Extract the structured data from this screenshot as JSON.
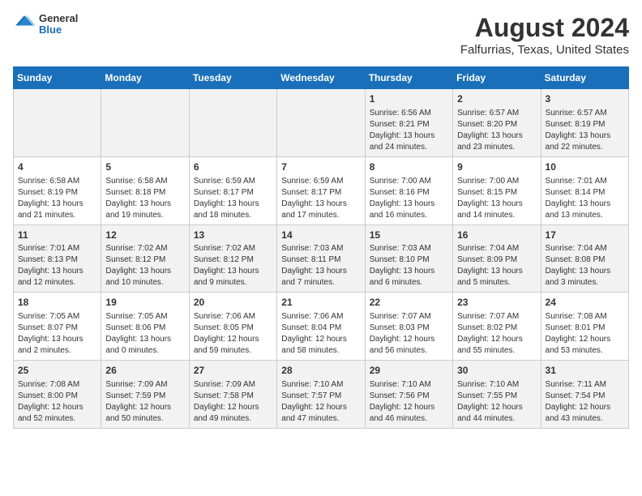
{
  "header": {
    "logo_general": "General",
    "logo_blue": "Blue",
    "title": "August 2024",
    "subtitle": "Falfurrias, Texas, United States"
  },
  "days_of_week": [
    "Sunday",
    "Monday",
    "Tuesday",
    "Wednesday",
    "Thursday",
    "Friday",
    "Saturday"
  ],
  "weeks": [
    [
      {
        "day": "",
        "info": ""
      },
      {
        "day": "",
        "info": ""
      },
      {
        "day": "",
        "info": ""
      },
      {
        "day": "",
        "info": ""
      },
      {
        "day": "1",
        "info": "Sunrise: 6:56 AM\nSunset: 8:21 PM\nDaylight: 13 hours\nand 24 minutes."
      },
      {
        "day": "2",
        "info": "Sunrise: 6:57 AM\nSunset: 8:20 PM\nDaylight: 13 hours\nand 23 minutes."
      },
      {
        "day": "3",
        "info": "Sunrise: 6:57 AM\nSunset: 8:19 PM\nDaylight: 13 hours\nand 22 minutes."
      }
    ],
    [
      {
        "day": "4",
        "info": "Sunrise: 6:58 AM\nSunset: 8:19 PM\nDaylight: 13 hours\nand 21 minutes."
      },
      {
        "day": "5",
        "info": "Sunrise: 6:58 AM\nSunset: 8:18 PM\nDaylight: 13 hours\nand 19 minutes."
      },
      {
        "day": "6",
        "info": "Sunrise: 6:59 AM\nSunset: 8:17 PM\nDaylight: 13 hours\nand 18 minutes."
      },
      {
        "day": "7",
        "info": "Sunrise: 6:59 AM\nSunset: 8:17 PM\nDaylight: 13 hours\nand 17 minutes."
      },
      {
        "day": "8",
        "info": "Sunrise: 7:00 AM\nSunset: 8:16 PM\nDaylight: 13 hours\nand 16 minutes."
      },
      {
        "day": "9",
        "info": "Sunrise: 7:00 AM\nSunset: 8:15 PM\nDaylight: 13 hours\nand 14 minutes."
      },
      {
        "day": "10",
        "info": "Sunrise: 7:01 AM\nSunset: 8:14 PM\nDaylight: 13 hours\nand 13 minutes."
      }
    ],
    [
      {
        "day": "11",
        "info": "Sunrise: 7:01 AM\nSunset: 8:13 PM\nDaylight: 13 hours\nand 12 minutes."
      },
      {
        "day": "12",
        "info": "Sunrise: 7:02 AM\nSunset: 8:12 PM\nDaylight: 13 hours\nand 10 minutes."
      },
      {
        "day": "13",
        "info": "Sunrise: 7:02 AM\nSunset: 8:12 PM\nDaylight: 13 hours\nand 9 minutes."
      },
      {
        "day": "14",
        "info": "Sunrise: 7:03 AM\nSunset: 8:11 PM\nDaylight: 13 hours\nand 7 minutes."
      },
      {
        "day": "15",
        "info": "Sunrise: 7:03 AM\nSunset: 8:10 PM\nDaylight: 13 hours\nand 6 minutes."
      },
      {
        "day": "16",
        "info": "Sunrise: 7:04 AM\nSunset: 8:09 PM\nDaylight: 13 hours\nand 5 minutes."
      },
      {
        "day": "17",
        "info": "Sunrise: 7:04 AM\nSunset: 8:08 PM\nDaylight: 13 hours\nand 3 minutes."
      }
    ],
    [
      {
        "day": "18",
        "info": "Sunrise: 7:05 AM\nSunset: 8:07 PM\nDaylight: 13 hours\nand 2 minutes."
      },
      {
        "day": "19",
        "info": "Sunrise: 7:05 AM\nSunset: 8:06 PM\nDaylight: 13 hours\nand 0 minutes."
      },
      {
        "day": "20",
        "info": "Sunrise: 7:06 AM\nSunset: 8:05 PM\nDaylight: 12 hours\nand 59 minutes."
      },
      {
        "day": "21",
        "info": "Sunrise: 7:06 AM\nSunset: 8:04 PM\nDaylight: 12 hours\nand 58 minutes."
      },
      {
        "day": "22",
        "info": "Sunrise: 7:07 AM\nSunset: 8:03 PM\nDaylight: 12 hours\nand 56 minutes."
      },
      {
        "day": "23",
        "info": "Sunrise: 7:07 AM\nSunset: 8:02 PM\nDaylight: 12 hours\nand 55 minutes."
      },
      {
        "day": "24",
        "info": "Sunrise: 7:08 AM\nSunset: 8:01 PM\nDaylight: 12 hours\nand 53 minutes."
      }
    ],
    [
      {
        "day": "25",
        "info": "Sunrise: 7:08 AM\nSunset: 8:00 PM\nDaylight: 12 hours\nand 52 minutes."
      },
      {
        "day": "26",
        "info": "Sunrise: 7:09 AM\nSunset: 7:59 PM\nDaylight: 12 hours\nand 50 minutes."
      },
      {
        "day": "27",
        "info": "Sunrise: 7:09 AM\nSunset: 7:58 PM\nDaylight: 12 hours\nand 49 minutes."
      },
      {
        "day": "28",
        "info": "Sunrise: 7:10 AM\nSunset: 7:57 PM\nDaylight: 12 hours\nand 47 minutes."
      },
      {
        "day": "29",
        "info": "Sunrise: 7:10 AM\nSunset: 7:56 PM\nDaylight: 12 hours\nand 46 minutes."
      },
      {
        "day": "30",
        "info": "Sunrise: 7:10 AM\nSunset: 7:55 PM\nDaylight: 12 hours\nand 44 minutes."
      },
      {
        "day": "31",
        "info": "Sunrise: 7:11 AM\nSunset: 7:54 PM\nDaylight: 12 hours\nand 43 minutes."
      }
    ]
  ]
}
